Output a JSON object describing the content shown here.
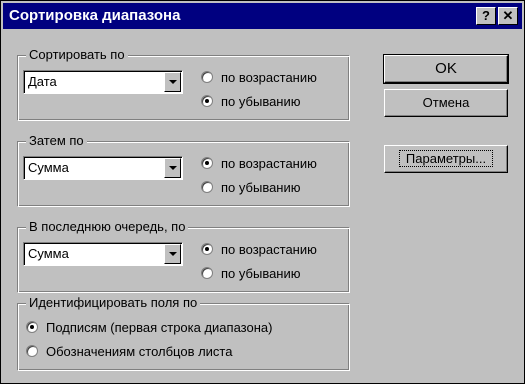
{
  "title": "Сортировка диапазона",
  "titlebar_buttons": {
    "help": "?",
    "close": "✕"
  },
  "sort_by": {
    "label": "Сортировать по",
    "value": "Дата",
    "asc": "по возрастанию",
    "desc": "по убыванию",
    "selected": "desc"
  },
  "then_by": {
    "label": "Затем по",
    "value": "Сумма",
    "asc": "по возрастанию",
    "desc": "по убыванию",
    "selected": "asc"
  },
  "last_by": {
    "label": "В последнюю очередь, по",
    "value": "Сумма",
    "asc": "по возрастанию",
    "desc": "по убыванию",
    "selected": "asc"
  },
  "identify": {
    "label": "Идентифицировать поля по",
    "opt_headers": "Подписям (первая строка диапазона)",
    "opt_columns": "Обозначениям столбцов листа",
    "selected": "headers"
  },
  "buttons": {
    "ok": "OK",
    "cancel": "Отмена",
    "params": "Параметры..."
  }
}
